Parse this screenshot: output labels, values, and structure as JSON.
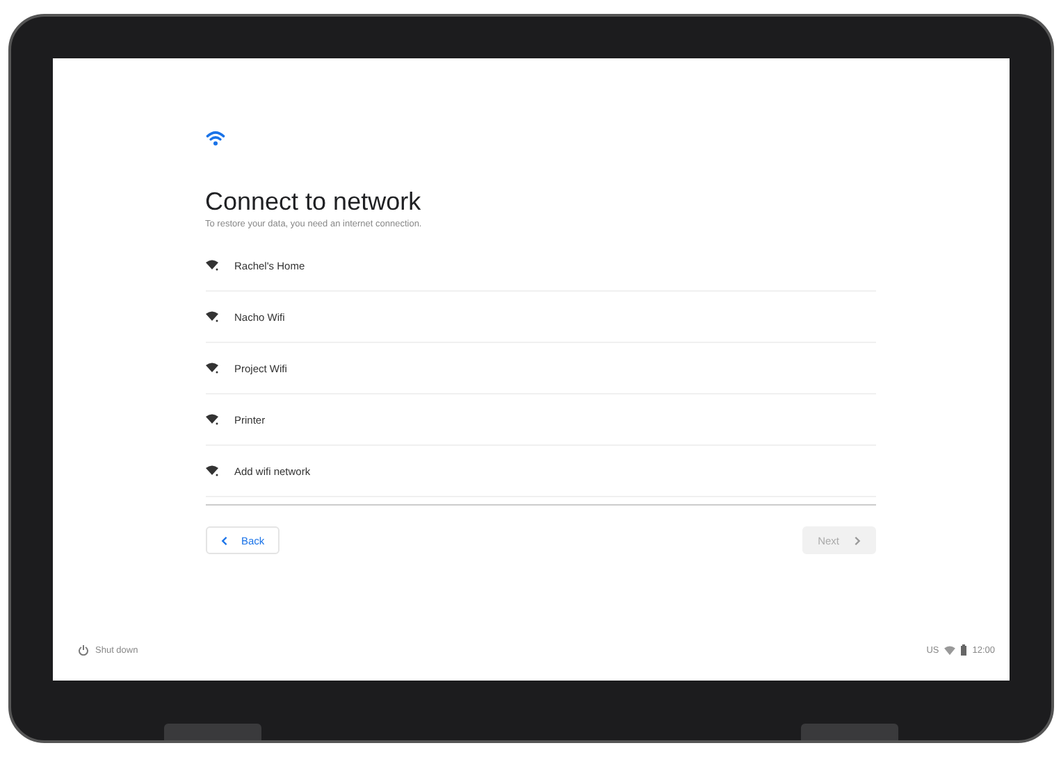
{
  "title": "Connect to network",
  "subtitle": "To restore your data, you need an internet connection.",
  "networks": [
    {
      "name": "Rachel's Home"
    },
    {
      "name": "Nacho Wifi"
    },
    {
      "name": "Project Wifi"
    },
    {
      "name": "Printer"
    },
    {
      "name": "Add wifi network"
    }
  ],
  "back_button": {
    "label": "Back"
  },
  "next_button": {
    "label": "Next",
    "disabled": true
  },
  "shutdown": {
    "label": "Shut down"
  },
  "status_tray": {
    "locale": "US",
    "time": "12:00"
  }
}
